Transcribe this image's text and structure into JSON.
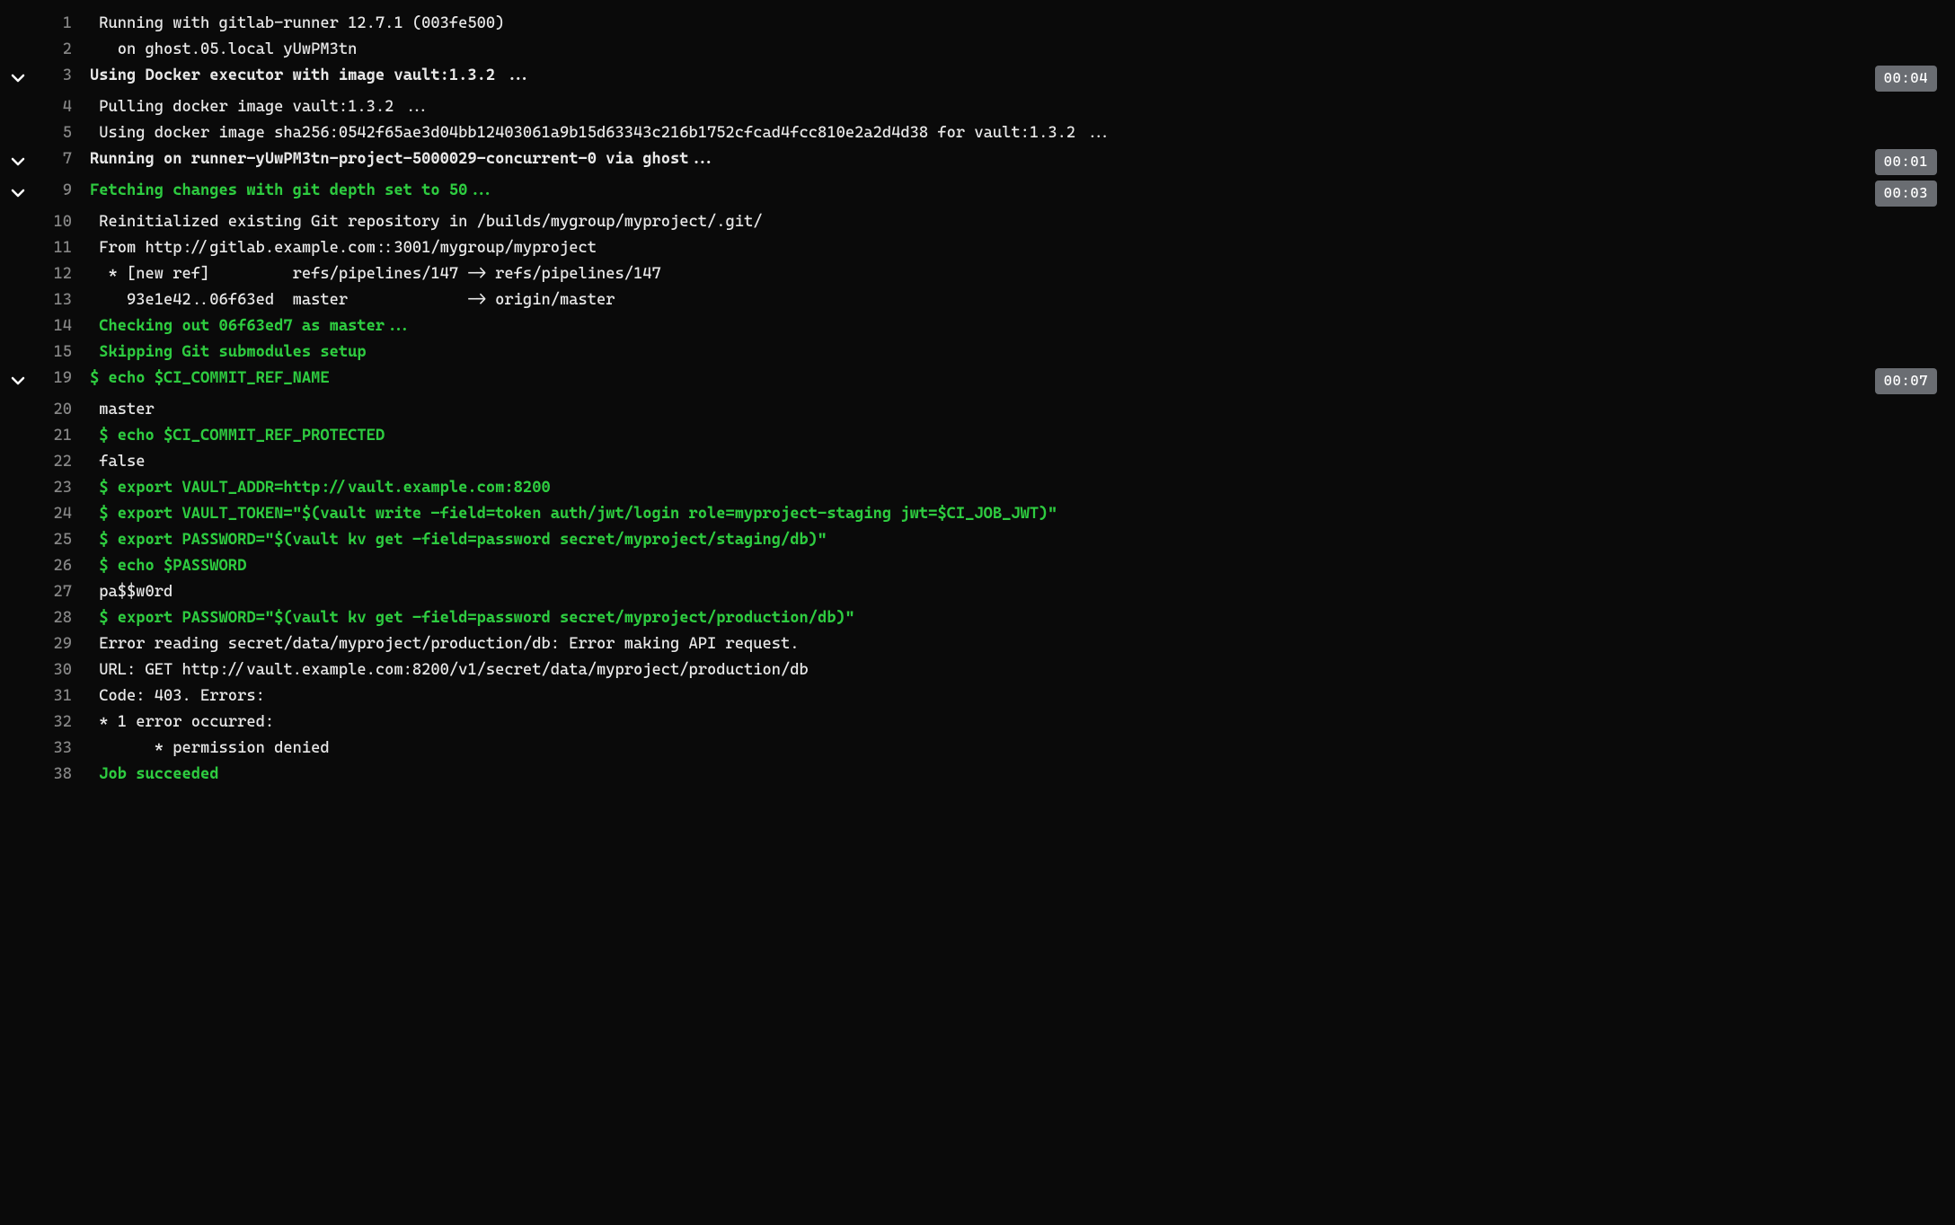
{
  "lines": [
    {
      "num": "1",
      "text": " Running with gitlab-runner 12.7.1 (003fe500)",
      "collapsible": false,
      "green": false,
      "duration": null
    },
    {
      "num": "2",
      "text": "   on ghost.05.local yUwPM3tn",
      "collapsible": false,
      "green": false,
      "duration": null
    },
    {
      "num": "3",
      "text": "Using Docker executor with image vault:1.3.2 ...",
      "collapsible": true,
      "green": false,
      "bold": true,
      "duration": "00:04"
    },
    {
      "num": "4",
      "text": " Pulling docker image vault:1.3.2 ...",
      "collapsible": false,
      "green": false,
      "duration": null
    },
    {
      "num": "5",
      "text": " Using docker image sha256:0542f65ae3d04bb12403061a9b15d63343c216b1752cfcad4fcc810e2a2d4d38 for vault:1.3.2 ...",
      "collapsible": false,
      "green": false,
      "duration": null
    },
    {
      "num": "7",
      "text": "Running on runner-yUwPM3tn-project-5000029-concurrent-0 via ghost...",
      "collapsible": true,
      "green": false,
      "bold": true,
      "duration": "00:01"
    },
    {
      "num": "9",
      "text": "Fetching changes with git depth set to 50...",
      "collapsible": true,
      "green": true,
      "duration": "00:03"
    },
    {
      "num": "10",
      "text": " Reinitialized existing Git repository in /builds/mygroup/myproject/.git/",
      "collapsible": false,
      "green": false,
      "duration": null
    },
    {
      "num": "11",
      "text": " From http://gitlab.example.com::3001/mygroup/myproject",
      "collapsible": false,
      "green": false,
      "duration": null
    },
    {
      "num": "12",
      "text": "  * [new ref]         refs/pipelines/147 -> refs/pipelines/147",
      "collapsible": false,
      "green": false,
      "duration": null
    },
    {
      "num": "13",
      "text": "    93e1e42..06f63ed  master             -> origin/master",
      "collapsible": false,
      "green": false,
      "duration": null
    },
    {
      "num": "14",
      "text": " Checking out 06f63ed7 as master...",
      "collapsible": false,
      "green": true,
      "duration": null
    },
    {
      "num": "15",
      "text": " Skipping Git submodules setup",
      "collapsible": false,
      "green": true,
      "duration": null
    },
    {
      "num": "19",
      "text": "$ echo $CI_COMMIT_REF_NAME",
      "collapsible": true,
      "green": true,
      "duration": "00:07"
    },
    {
      "num": "20",
      "text": " master",
      "collapsible": false,
      "green": false,
      "duration": null
    },
    {
      "num": "21",
      "text": " $ echo $CI_COMMIT_REF_PROTECTED",
      "collapsible": false,
      "green": true,
      "duration": null
    },
    {
      "num": "22",
      "text": " false",
      "collapsible": false,
      "green": false,
      "duration": null
    },
    {
      "num": "23",
      "text": " $ export VAULT_ADDR=http://vault.example.com:8200",
      "collapsible": false,
      "green": true,
      "duration": null
    },
    {
      "num": "24",
      "text": " $ export VAULT_TOKEN=\"$(vault write -field=token auth/jwt/login role=myproject-staging jwt=$CI_JOB_JWT)\"",
      "collapsible": false,
      "green": true,
      "duration": null
    },
    {
      "num": "25",
      "text": " $ export PASSWORD=\"$(vault kv get -field=password secret/myproject/staging/db)\"",
      "collapsible": false,
      "green": true,
      "duration": null
    },
    {
      "num": "26",
      "text": " $ echo $PASSWORD",
      "collapsible": false,
      "green": true,
      "duration": null
    },
    {
      "num": "27",
      "text": " pa$$w0rd",
      "collapsible": false,
      "green": false,
      "duration": null
    },
    {
      "num": "28",
      "text": " $ export PASSWORD=\"$(vault kv get -field=password secret/myproject/production/db)\"",
      "collapsible": false,
      "green": true,
      "duration": null
    },
    {
      "num": "29",
      "text": " Error reading secret/data/myproject/production/db: Error making API request.",
      "collapsible": false,
      "green": false,
      "duration": null
    },
    {
      "num": "30",
      "text": " URL: GET http://vault.example.com:8200/v1/secret/data/myproject/production/db",
      "collapsible": false,
      "green": false,
      "duration": null
    },
    {
      "num": "31",
      "text": " Code: 403. Errors:",
      "collapsible": false,
      "green": false,
      "duration": null
    },
    {
      "num": "32",
      "text": " * 1 error occurred:",
      "collapsible": false,
      "green": false,
      "duration": null
    },
    {
      "num": "33",
      "text": "       * permission denied",
      "collapsible": false,
      "green": false,
      "duration": null
    },
    {
      "num": "38",
      "text": " Job succeeded",
      "collapsible": false,
      "green": true,
      "duration": null
    }
  ]
}
